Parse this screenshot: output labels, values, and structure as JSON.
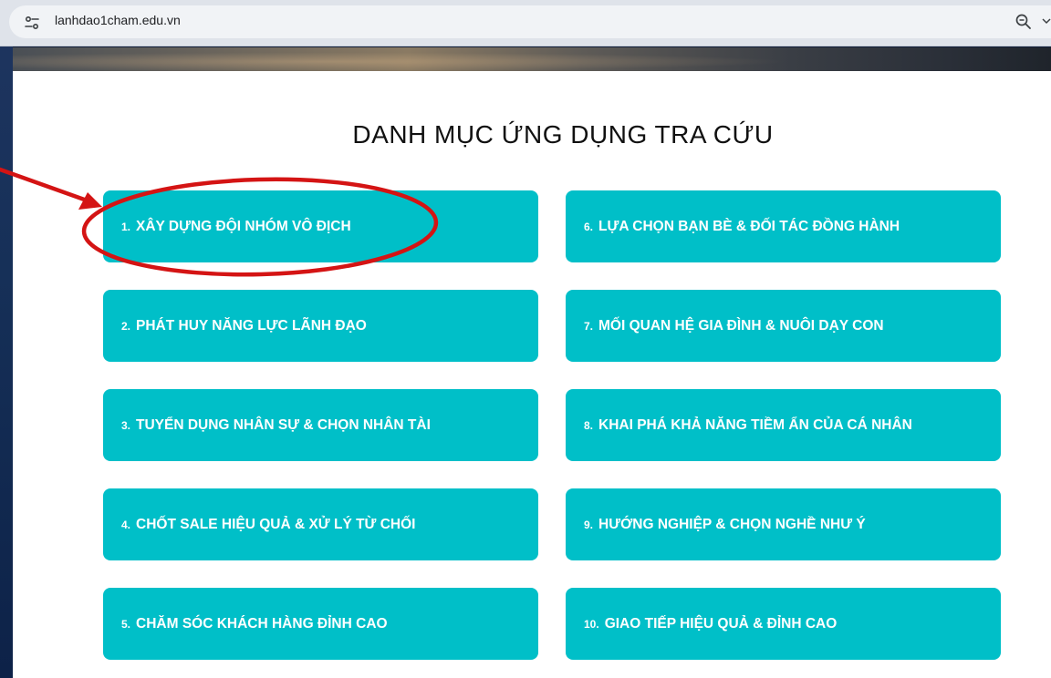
{
  "browser": {
    "url": "lanhdao1cham.edu.vn",
    "icons": [
      "site-info-icon",
      "zoom-icon",
      "chevron-down-icon"
    ]
  },
  "page": {
    "title": "DANH MỤC ỨNG DỤNG TRA CỨU",
    "items": [
      {
        "num": "1.",
        "label": "XÂY DỰNG ĐỘI NHÓM VÔ ĐỊCH"
      },
      {
        "num": "2.",
        "label": "PHÁT HUY NĂNG LỰC LÃNH ĐẠO"
      },
      {
        "num": "3.",
        "label": "TUYỂN DỤNG NHÂN SỰ & CHỌN NHÂN TÀI"
      },
      {
        "num": "4.",
        "label": "CHỐT SALE HIỆU QUẢ & XỬ LÝ TỪ CHỐI"
      },
      {
        "num": "5.",
        "label": "CHĂM SÓC KHÁCH HÀNG ĐỈNH CAO"
      },
      {
        "num": "6.",
        "label": "LỰA CHỌN BẠN BÈ & ĐỐI TÁC ĐỒNG HÀNH"
      },
      {
        "num": "7.",
        "label": "MỐI QUAN HỆ GIA ĐÌNH & NUÔI DẠY CON"
      },
      {
        "num": "8.",
        "label": "KHAI PHÁ KHẢ NĂNG TIỀM ẨN CỦA CÁ NHÂN"
      },
      {
        "num": "9.",
        "label": "HƯỚNG NGHIỆP & CHỌN NGHỀ NHƯ Ý"
      },
      {
        "num": "10.",
        "label": "GIAO TIẾP HIỆU QUẢ & ĐỈNH CAO"
      }
    ]
  },
  "colors": {
    "tile": "#00bfc8",
    "tile_text": "#ffffff",
    "annotation": "#d41414"
  }
}
